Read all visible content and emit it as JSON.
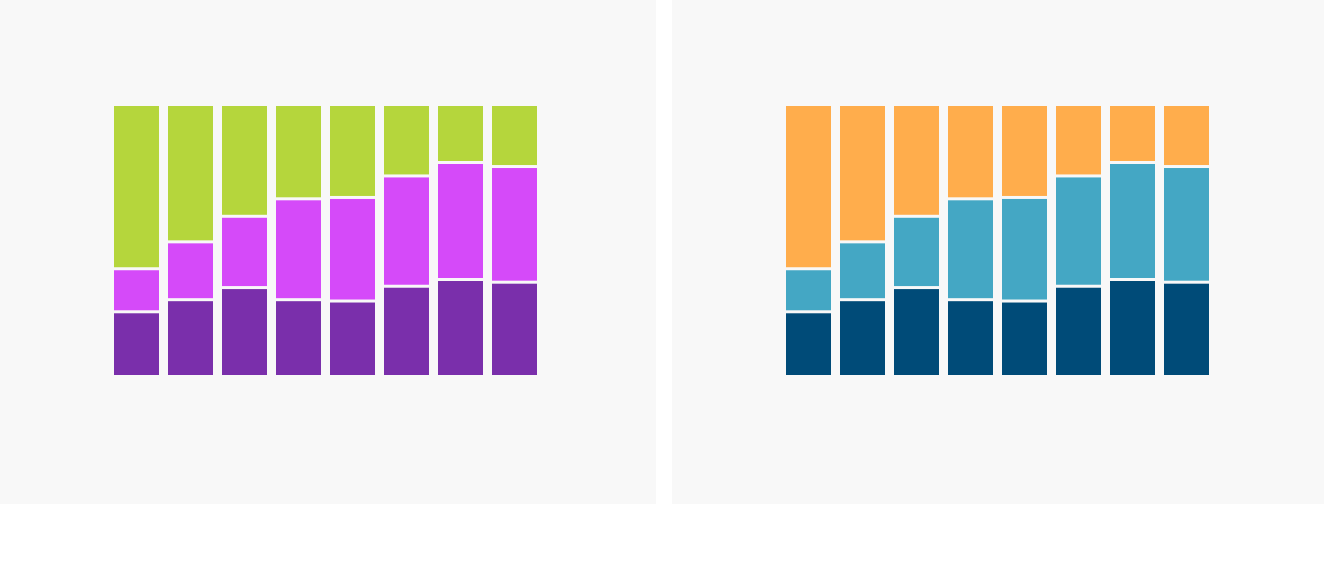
{
  "captions": {
    "left": "",
    "right": ""
  },
  "chart_data": [
    {
      "type": "bar",
      "stacked": true,
      "normalized": true,
      "categories": [
        "",
        "",
        "",
        "",
        "",
        "",
        "",
        ""
      ],
      "ylim": [
        0,
        100
      ],
      "grid": false,
      "series": [
        {
          "color": "#7a2fab",
          "values": [
            23.5,
            28,
            32.5,
            28,
            27.5,
            33,
            35.5,
            34.5
          ]
        },
        {
          "color": "#d54af9",
          "values": [
            16,
            21.5,
            26.5,
            37.5,
            38.5,
            41,
            43.5,
            43
          ]
        },
        {
          "color": "#b5d63c",
          "values": [
            60.5,
            50.5,
            41,
            34.5,
            34,
            26,
            21,
            22.5
          ]
        }
      ]
    },
    {
      "type": "bar",
      "stacked": true,
      "normalized": true,
      "categories": [
        "",
        "",
        "",
        "",
        "",
        "",
        "",
        ""
      ],
      "ylim": [
        0,
        100
      ],
      "grid": false,
      "series": [
        {
          "color": "#004b78",
          "values": [
            23.5,
            28,
            32.5,
            28,
            27.5,
            33,
            35.5,
            34.5
          ]
        },
        {
          "color": "#44a7c4",
          "values": [
            16,
            21.5,
            26.5,
            37.5,
            38.5,
            41,
            43.5,
            43
          ]
        },
        {
          "color": "#ffad4c",
          "values": [
            60.5,
            50.5,
            41,
            34.5,
            34,
            26,
            21,
            22.5
          ]
        }
      ]
    }
  ]
}
